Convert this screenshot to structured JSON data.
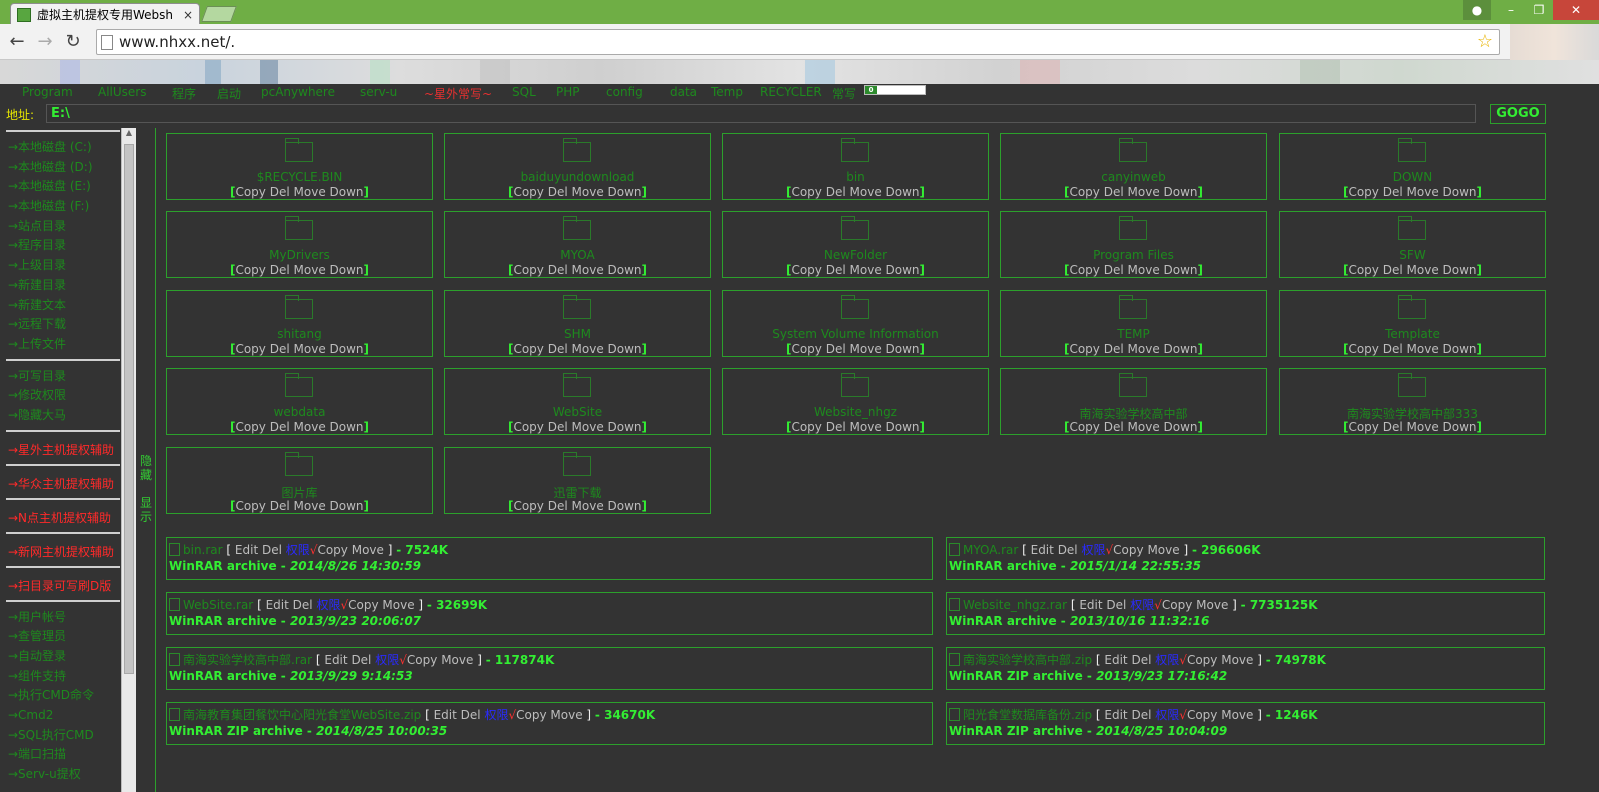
{
  "browser": {
    "tab_title": "虚拟主机提权专用Websh",
    "tab_close": "×",
    "url": "www.nhxx.net/."
  },
  "quicklinks": [
    {
      "label": "Program",
      "red": false
    },
    {
      "label": "AllUsers",
      "red": false
    },
    {
      "label": "程序",
      "red": false
    },
    {
      "label": "启动",
      "red": false
    },
    {
      "label": "pcAnywhere",
      "red": false
    },
    {
      "label": "serv-u",
      "red": false
    },
    {
      "label": "~星外常写~",
      "red": true
    },
    {
      "label": "SQL",
      "red": false
    },
    {
      "label": "PHP",
      "red": false
    },
    {
      "label": "config",
      "red": false
    },
    {
      "label": "data",
      "red": false
    },
    {
      "label": "Temp",
      "red": false
    },
    {
      "label": "RECYCLER",
      "red": false
    },
    {
      "label": "常写",
      "red": false
    }
  ],
  "address": {
    "label": "地址:",
    "value": "E:\\",
    "go_label": "GOGO"
  },
  "sidebar": {
    "group1": [
      "→本地磁盘 (C:)",
      "→本地磁盘 (D:)",
      "→本地磁盘 (E:)",
      "→本地磁盘 (F:)",
      "→站点目录",
      "→程序目录",
      "→上级目录",
      "→新建目录",
      "→新建文本",
      "→远程下载",
      "→上传文件"
    ],
    "group2": [
      "→可写目录",
      "→修改权限",
      "→隐藏大马"
    ],
    "red_items": [
      "→星外主机提权辅助",
      "→华众主机提权辅助",
      "→N点主机提权辅助",
      "→新网主机提权辅助",
      "→扫目录可写刷D版"
    ],
    "group3": [
      "→用户帐号",
      "→查管理员",
      "→自动登录",
      "→组件支持",
      "→执行CMD命令",
      "→Cmd2",
      "→SQL执行CMD",
      "→端口扫描",
      "→Serv-u提权"
    ]
  },
  "hide_toggle": {
    "hide": "隐藏",
    "show": "显示"
  },
  "folder_actions": {
    "open": "[",
    "copy": "Copy",
    "del": "Del",
    "move": "Move",
    "down": "Down",
    "close": "]"
  },
  "folders": [
    "$RECYCLE.BIN",
    "baiduyundownload",
    "bin",
    "canyinweb",
    "DOWN",
    "MyDrivers",
    "MYOA",
    "NewFolder",
    "Program Files",
    "SFW",
    "shitang",
    "SHM",
    "System Volume Information",
    "TEMP",
    "Template",
    "webdata",
    "WebSite",
    "Website_nhgz",
    "南海实验学校高中部",
    "南海实验学校高中部333",
    "图片库",
    "迅雷下载"
  ],
  "file_actions": {
    "edit": "Edit",
    "del": "Del",
    "perm": "权限",
    "check": "√",
    "copy": "Copy",
    "move": "Move"
  },
  "files": [
    {
      "name": "bin.rar",
      "size": "7524K",
      "type": "WinRAR archive",
      "date": "2014/8/26 14:30:59"
    },
    {
      "name": "MYOA.rar",
      "size": "296606K",
      "type": "WinRAR archive",
      "date": "2015/1/14 22:55:35"
    },
    {
      "name": "WebSite.rar",
      "size": "32699K",
      "type": "WinRAR archive",
      "date": "2013/9/23 20:06:07"
    },
    {
      "name": "Website_nhgz.rar",
      "size": "7735125K",
      "type": "WinRAR archive",
      "date": "2013/10/16 11:32:16"
    },
    {
      "name": "南海实验学校高中部.rar",
      "size": "117874K",
      "type": "WinRAR archive",
      "date": "2013/9/29 9:14:53"
    },
    {
      "name": "南海实验学校高中部.zip",
      "size": "74978K",
      "type": "WinRAR ZIP archive",
      "date": "2013/9/23 17:16:42"
    },
    {
      "name": "南海教育集团餐饮中心阳光食堂WebSite.zip",
      "size": "34670K",
      "type": "WinRAR ZIP archive",
      "date": "2014/8/25 10:00:35"
    },
    {
      "name": "阳光食堂数据库备份.zip",
      "size": "1246K",
      "type": "WinRAR ZIP archive",
      "date": "2014/8/25 10:04:09"
    }
  ],
  "colors": {
    "background": "#333333",
    "green": "#33ee33",
    "dark_green": "#1e8a1e",
    "red": "#ff2a2a",
    "chrome_green": "#6fae45"
  }
}
